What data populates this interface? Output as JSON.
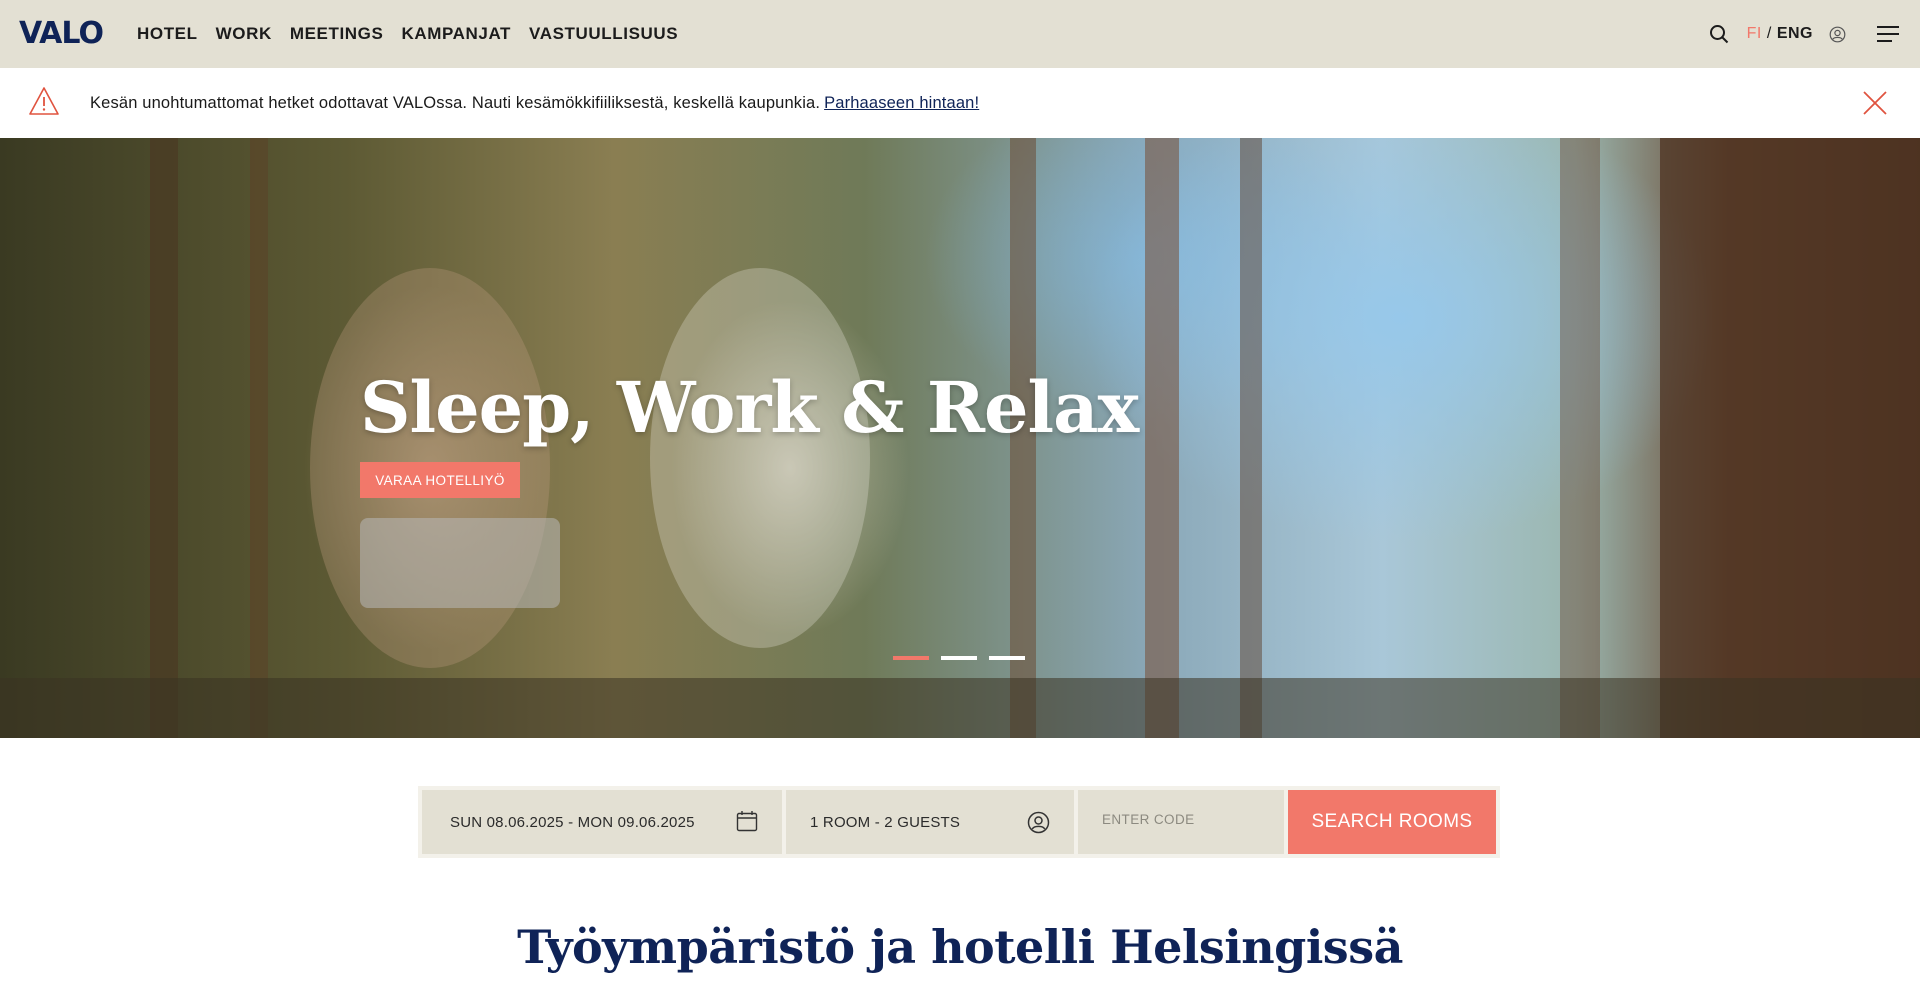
{
  "header": {
    "logo": "VALO",
    "nav": [
      "HOTEL",
      "WORK",
      "MEETINGS",
      "KAMPANJAT",
      "VASTUULLISUUS"
    ],
    "lang_fi": "FI",
    "lang_sep": "/",
    "lang_eng": "ENG",
    "icons": [
      "search-icon",
      "user-icon",
      "menu-icon"
    ]
  },
  "alert": {
    "text": "Kesän unohtumattomat hetket odottavat VALOssa. Nauti kesämökkifiiliksestä, keskellä kaupunkia.",
    "link": "Parhaaseen hintaan!",
    "icons": [
      "warning-icon",
      "close-icon"
    ]
  },
  "hero": {
    "title": "Sleep, Work & Relax",
    "button": "VARAA HOTELLIYÖ",
    "slides": 3,
    "active_slide": 1
  },
  "booking": {
    "dates": "SUN 08.06.2025 - MON 09.06.2025",
    "guests": "1 ROOM - 2 GUESTS",
    "code_placeholder": "ENTER CODE",
    "search": "SEARCH ROOMS"
  },
  "section": {
    "title": "Työympäristö ja hotelli Helsingissä"
  },
  "colors": {
    "header_bg": "#e3e0d3",
    "brand_navy": "#0f2357",
    "accent_coral": "#f2786a"
  }
}
